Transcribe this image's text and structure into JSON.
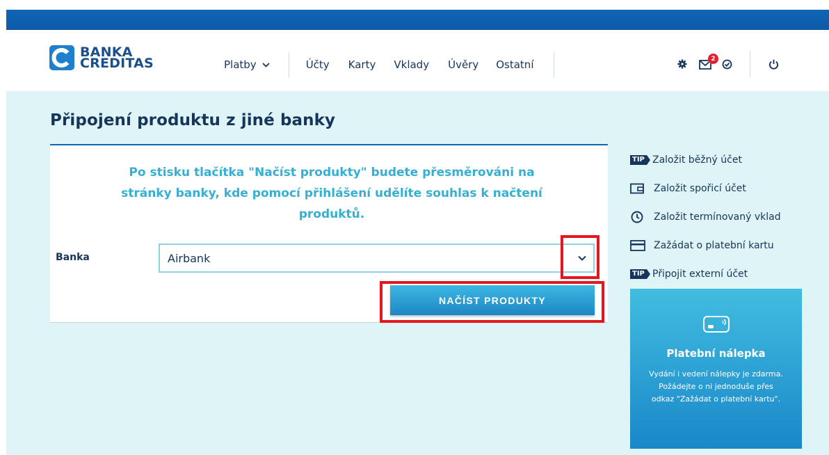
{
  "brand": {
    "name_line1": "BANKA",
    "name_line2": "CREDITAS"
  },
  "nav": {
    "platby": "Platby",
    "ucty": "Účty",
    "karty": "Karty",
    "vklady": "Vklady",
    "uvery": "Úvěry",
    "ostatni": "Ostatní"
  },
  "header": {
    "messages_badge": "2"
  },
  "page": {
    "title": "Připojení produktu z jiné banky"
  },
  "form": {
    "message": "Po stisku tlačítka \"Načíst produkty\" budete přesměrováni na stránky banky, kde pomocí přihlášení udělíte souhlas k načtení produktů.",
    "bank_label": "Banka",
    "bank_selected": "Airbank",
    "load_button": "NAČÍST PRODUKTY"
  },
  "sidebar": {
    "links": [
      {
        "icon": "tip-icon",
        "label": "Založit běžný účet"
      },
      {
        "icon": "wallet-icon",
        "label": "Založit spořicí účet"
      },
      {
        "icon": "clock-icon",
        "label": "Založit termínovaný vklad"
      },
      {
        "icon": "card-icon",
        "label": "Zažádat o platební kartu"
      },
      {
        "icon": "tip-icon",
        "label": "Připojit externí účet"
      }
    ],
    "tip_text": "TIP"
  },
  "promo": {
    "title": "Platební nálepka",
    "text": "Vydání i vedení nálepky je zdarma. Požádejte o ni jednoduše přes odkaz \"Zažádat o platební kartu\"."
  },
  "colors": {
    "primary": "#0f65b6",
    "accent": "#36afd2",
    "highlight": "#e4161e",
    "background": "#def4f7"
  }
}
